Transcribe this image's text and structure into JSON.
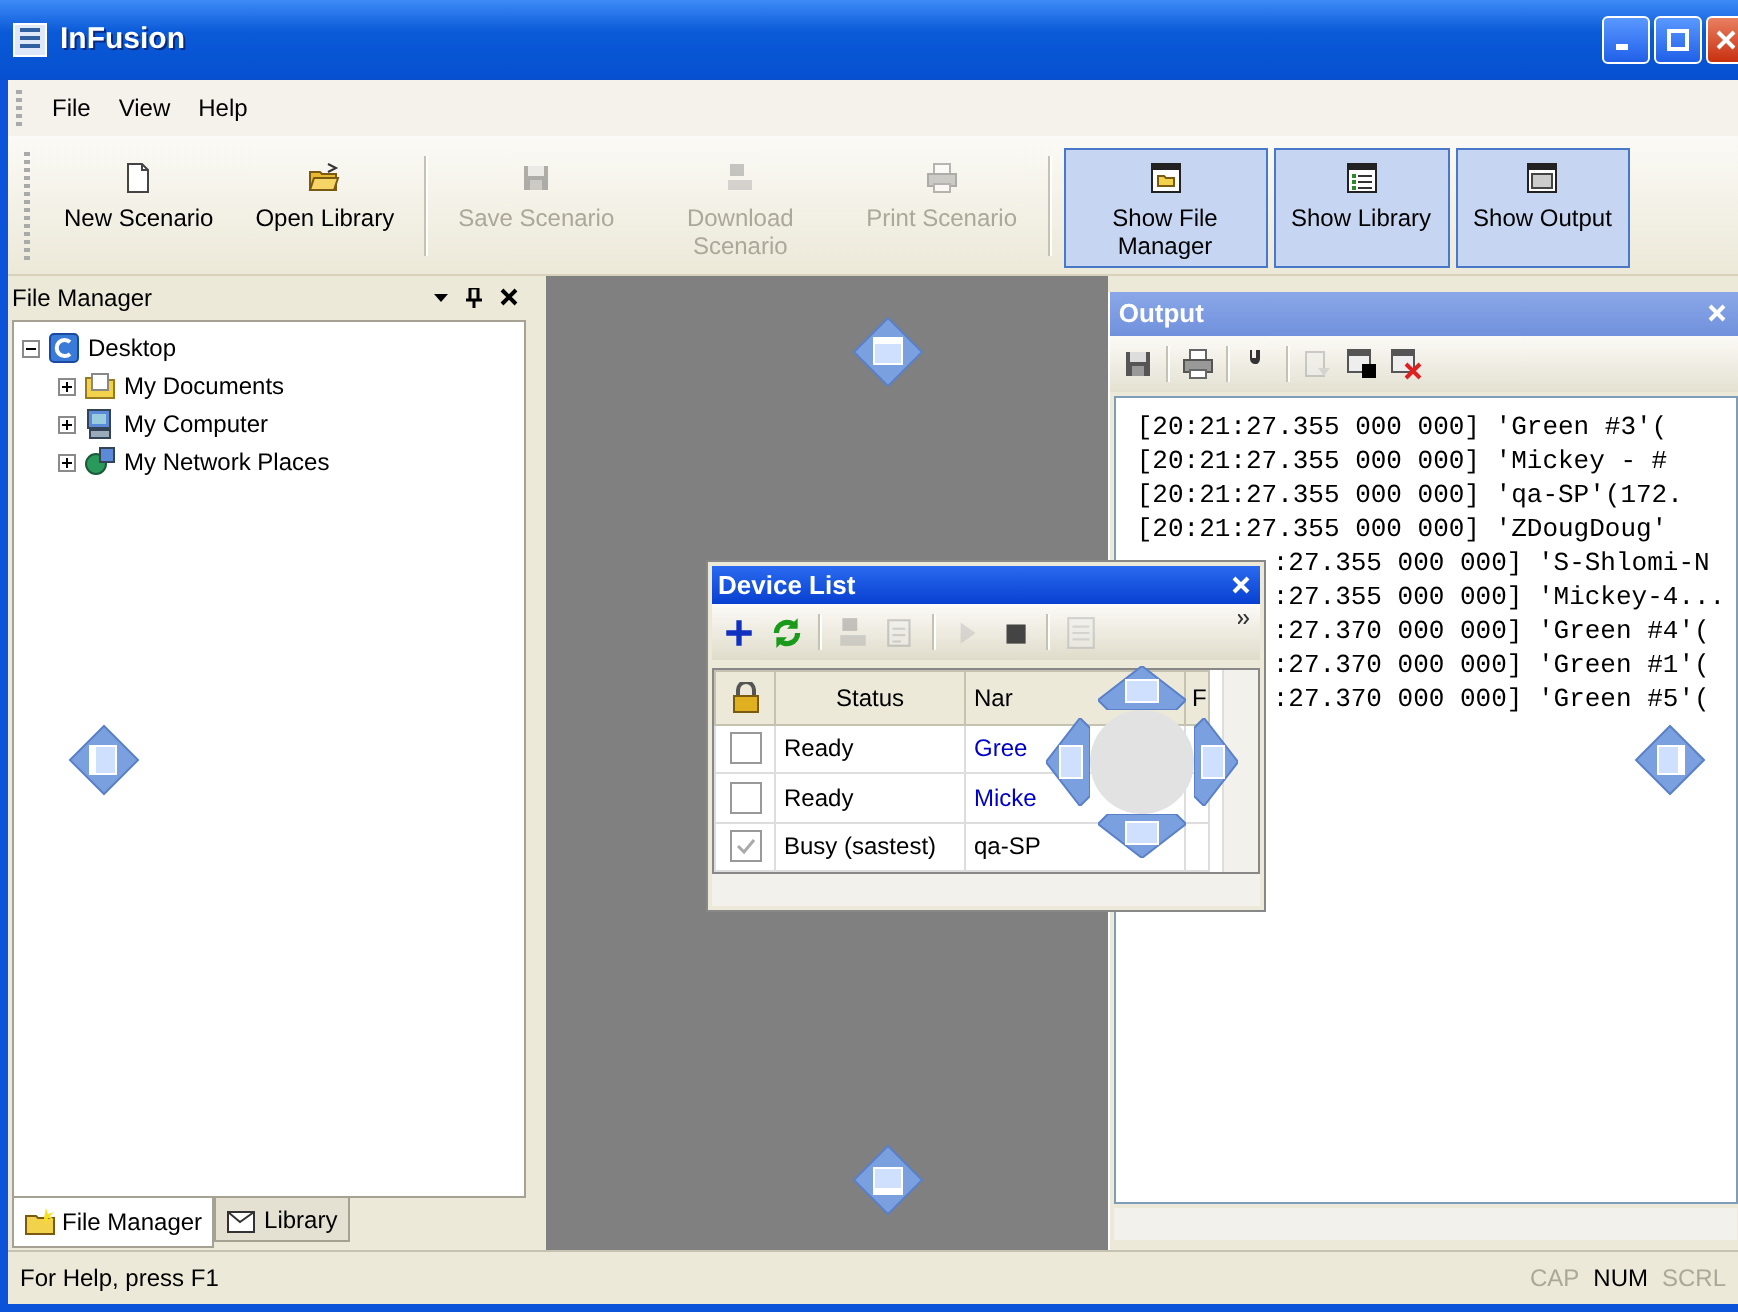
{
  "window": {
    "title": "InFusion"
  },
  "menu": [
    {
      "label": "File"
    },
    {
      "label": "View"
    },
    {
      "label": "Help"
    }
  ],
  "toolbar": [
    {
      "kind": "new",
      "label": "New Scenario",
      "disabled": false,
      "checked": false
    },
    {
      "kind": "open",
      "label": "Open Library",
      "disabled": false,
      "checked": false
    },
    {
      "kind": "separator"
    },
    {
      "kind": "save",
      "label": "Save Scenario",
      "disabled": true,
      "checked": false
    },
    {
      "kind": "download",
      "label": "Download Scenario",
      "disabled": true,
      "checked": false
    },
    {
      "kind": "print",
      "label": "Print Scenario",
      "disabled": true,
      "checked": false
    },
    {
      "kind": "separator"
    },
    {
      "kind": "show_files",
      "label": "Show File Manager",
      "disabled": false,
      "checked": true
    },
    {
      "kind": "show_library",
      "label": "Show Library",
      "disabled": false,
      "checked": true
    },
    {
      "kind": "show_output",
      "label": "Show Output",
      "disabled": false,
      "checked": true
    }
  ],
  "file_manager": {
    "title": "File Manager",
    "tree": [
      {
        "label": "Desktop",
        "kind": "desktop",
        "expanded": true,
        "children": [
          {
            "label": "My Documents",
            "kind": "documents",
            "expanded": false
          },
          {
            "label": "My Computer",
            "kind": "computer",
            "expanded": false
          },
          {
            "label": "My Network Places",
            "kind": "network",
            "expanded": false
          }
        ]
      }
    ],
    "tabs": [
      {
        "label": "File Manager",
        "kind": "files",
        "selected": true
      },
      {
        "label": "Library",
        "kind": "library",
        "selected": false
      }
    ]
  },
  "output": {
    "title": "Output",
    "toolbar": [
      {
        "kind": "save",
        "disabled": false
      },
      {
        "kind": "separator"
      },
      {
        "kind": "print",
        "disabled": false
      },
      {
        "kind": "separator"
      },
      {
        "kind": "settings",
        "disabled": false
      },
      {
        "kind": "separator"
      },
      {
        "kind": "export",
        "disabled": true
      },
      {
        "kind": "stop_window",
        "disabled": false
      },
      {
        "kind": "clear",
        "disabled": false
      }
    ],
    "lines": [
      {
        "kind": "full",
        "text": "[20:21:27.355 000 000] 'Green #3'("
      },
      {
        "kind": "full",
        "text": "[20:21:27.355 000 000] 'Mickey - #"
      },
      {
        "kind": "full",
        "text": "[20:21:27.355 000 000] 'qa-SP'(172."
      },
      {
        "kind": "full",
        "text": "[20:21:27.355 000 000] 'ZDougDoug'"
      },
      {
        "kind": "partial",
        "text": ":27.355 000 000] 'S-Shlomi-N"
      },
      {
        "kind": "partial",
        "text": ":27.355 000 000] 'Mickey-4..."
      },
      {
        "kind": "partial",
        "text": ":27.370 000 000] 'Green #4'("
      },
      {
        "kind": "partial",
        "text": ":27.370 000 000] 'Green #1'("
      },
      {
        "kind": "partial",
        "text": ":27.370 000 000] 'Green #5'("
      }
    ]
  },
  "device_list": {
    "title": "Device List",
    "toolbar": [
      {
        "kind": "add",
        "disabled": false
      },
      {
        "kind": "refresh",
        "disabled": false
      },
      {
        "kind": "separator"
      },
      {
        "kind": "download",
        "disabled": true
      },
      {
        "kind": "edit",
        "disabled": true
      },
      {
        "kind": "separator"
      },
      {
        "kind": "play",
        "disabled": true
      },
      {
        "kind": "stop",
        "disabled": false
      },
      {
        "kind": "separator"
      },
      {
        "kind": "properties",
        "disabled": true
      }
    ],
    "columns": [
      "Status",
      "Nar",
      "F"
    ],
    "rows": [
      {
        "checked": false,
        "status": "Ready",
        "name": "Gree",
        "color": "#0000cc"
      },
      {
        "checked": false,
        "status": "Ready",
        "name": "Micke",
        "color": "#0000cc"
      },
      {
        "checked": true,
        "status": "Busy (sastest)",
        "name": "qa-SP",
        "color": "#000000"
      }
    ]
  },
  "status_bar": {
    "text": "For Help, press F1",
    "indicators": [
      {
        "label": "CAP",
        "on": false
      },
      {
        "label": "NUM",
        "on": true
      },
      {
        "label": "SCRL",
        "on": false
      }
    ]
  }
}
